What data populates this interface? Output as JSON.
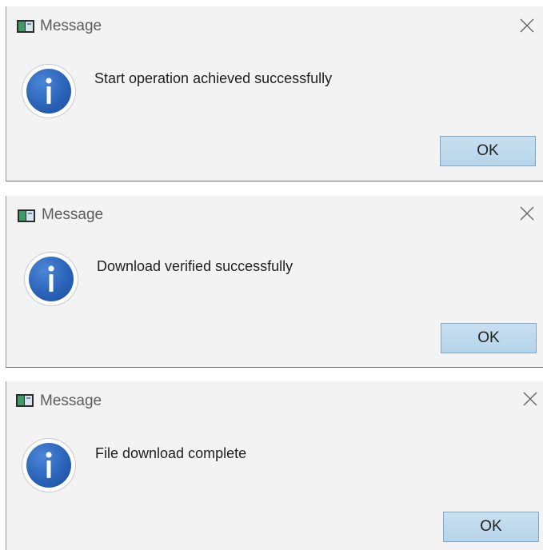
{
  "dialogs": [
    {
      "title": "Message",
      "message": "Start operation achieved successfully",
      "ok_label": "OK",
      "icon": "info-icon",
      "close_icon": "close-icon"
    },
    {
      "title": "Message",
      "message": "Download verified successfully",
      "ok_label": "OK",
      "icon": "info-icon",
      "close_icon": "close-icon"
    },
    {
      "title": "Message",
      "message": "File download complete",
      "ok_label": "OK",
      "icon": "info-icon",
      "close_icon": "close-icon"
    }
  ],
  "colors": {
    "dialog_bg": "#f3f3f3",
    "info_blue": "#2a63b8",
    "button_bg": "#b6d4ea",
    "button_border": "#7fa7c7"
  }
}
